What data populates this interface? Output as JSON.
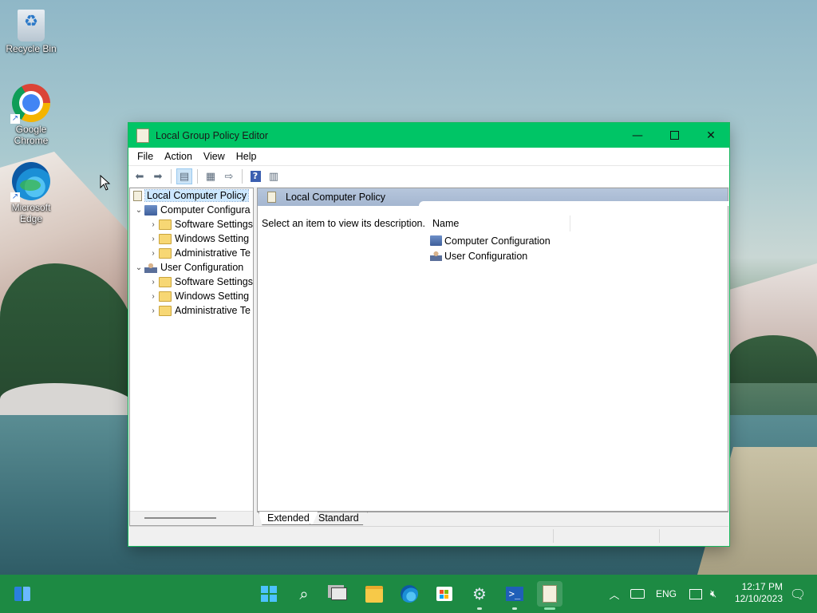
{
  "desktop": {
    "icons": [
      {
        "label": "Recycle Bin"
      },
      {
        "label": "Google Chrome"
      },
      {
        "label": "Microsoft Edge"
      }
    ]
  },
  "window": {
    "title": "Local Group Policy Editor",
    "menu": [
      "File",
      "Action",
      "View",
      "Help"
    ],
    "tree": {
      "root": "Local Computer Policy",
      "items": [
        {
          "label": "Computer Configura",
          "level": 1,
          "expanded": true
        },
        {
          "label": "Software Settings",
          "level": 2
        },
        {
          "label": "Windows Setting",
          "level": 2
        },
        {
          "label": "Administrative Te",
          "level": 2
        },
        {
          "label": "User Configuration",
          "level": 1,
          "expanded": true
        },
        {
          "label": "Software Settings",
          "level": 2
        },
        {
          "label": "Windows Setting",
          "level": 2
        },
        {
          "label": "Administrative Te",
          "level": 2
        }
      ]
    },
    "pane": {
      "header": "Local Computer Policy",
      "description": "Select an item to view its description.",
      "column_name": "Name",
      "items": [
        "Computer Configuration",
        "User Configuration"
      ]
    },
    "tabs": [
      "Extended",
      "Standard"
    ]
  },
  "taskbar": {
    "language": "ENG",
    "time": "12:17 PM",
    "date": "12/10/2023"
  },
  "colors": {
    "titlebar": "#00c566",
    "taskbar": "#1d8a43",
    "selection": "#cce8ff"
  }
}
